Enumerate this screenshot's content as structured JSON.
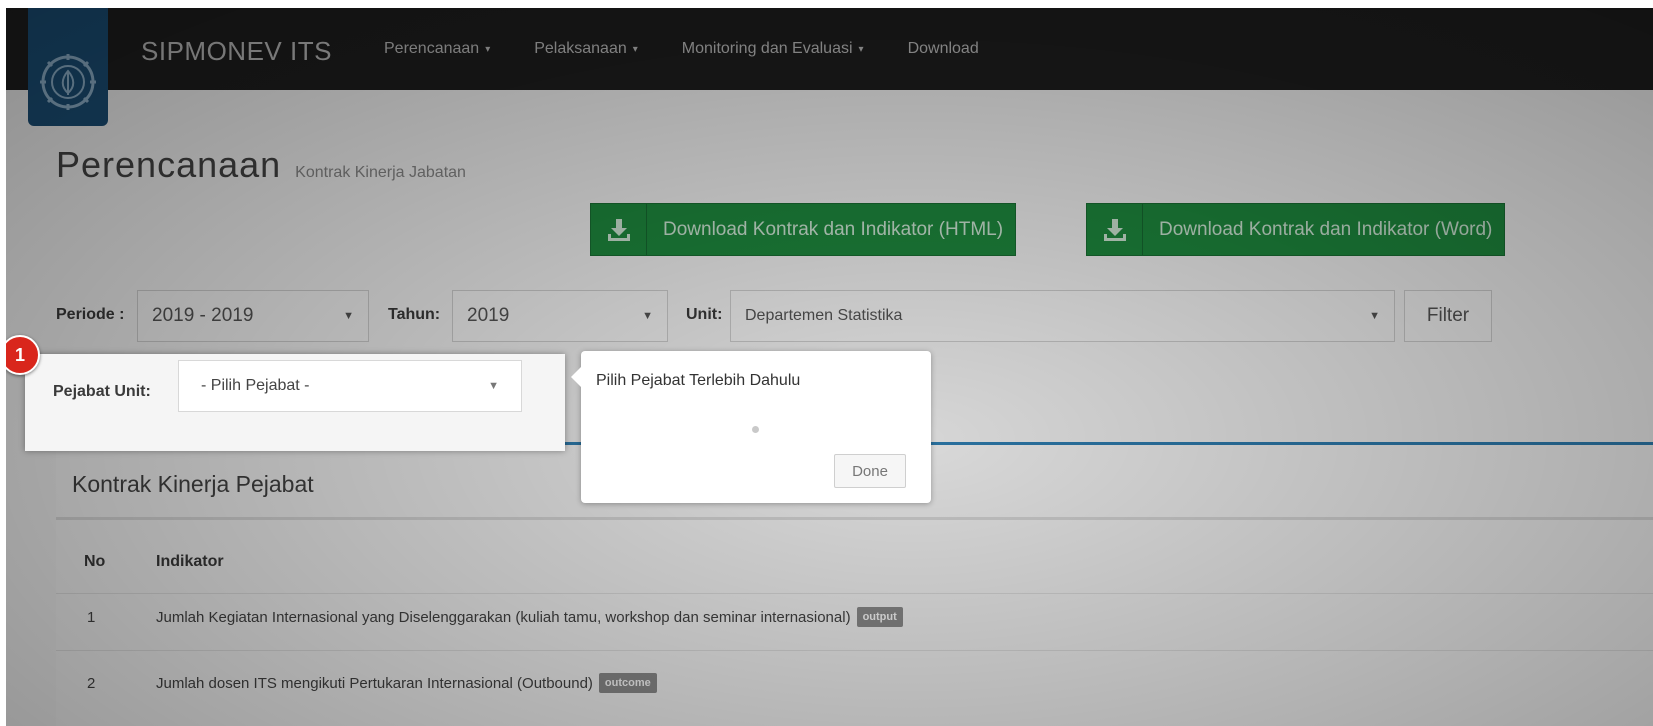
{
  "navbar": {
    "brand": "SIPMONEV ITS",
    "items": [
      {
        "label": "Perencanaan",
        "caret": "▾"
      },
      {
        "label": "Pelaksanaan",
        "caret": "▾"
      },
      {
        "label": "Monitoring dan Evaluasi",
        "caret": "▾"
      },
      {
        "label": "Download",
        "caret": ""
      }
    ]
  },
  "page": {
    "title": "Perencanaan",
    "subtitle": "Kontrak Kinerja Jabatan"
  },
  "buttons": {
    "download_html": "Download Kontrak dan Indikator (HTML)",
    "download_word": "Download Kontrak dan Indikator (Word)",
    "filter": "Filter"
  },
  "filters": {
    "periode_label": "Periode :",
    "periode_value": "2019 - 2019",
    "tahun_label": "Tahun:",
    "tahun_value": "2019",
    "unit_label": "Unit:",
    "unit_value": "Departemen Statistika",
    "pejabat_label": "Pejabat Unit:",
    "pejabat_value": "- Pilih Pejabat -"
  },
  "tour": {
    "step": "1",
    "message": "Pilih Pejabat Terlebih Dahulu",
    "done": "Done"
  },
  "table": {
    "title": "Kontrak Kinerja Pejabat",
    "headers": [
      "No",
      "Indikator"
    ],
    "rows": [
      {
        "no": "1",
        "indikator": "Jumlah Kegiatan Internasional yang Diselenggarakan (kuliah tamu, workshop dan seminar internasional)",
        "tag": "output"
      },
      {
        "no": "2",
        "indikator": "Jumlah dosen ITS mengikuti Pertukaran Internasional (Outbound)",
        "tag": "outcome"
      }
    ]
  },
  "colors": {
    "navbar": "#1e1e1e",
    "logo": "#1b4f77",
    "download_green": "#1e8a3e",
    "panel_accent": "#2f7fb3",
    "badge_red": "#d9261c"
  },
  "icons": {
    "logo": "its-seal-icon",
    "download": "download-tray-icon",
    "caret": "chevron-down-icon"
  }
}
